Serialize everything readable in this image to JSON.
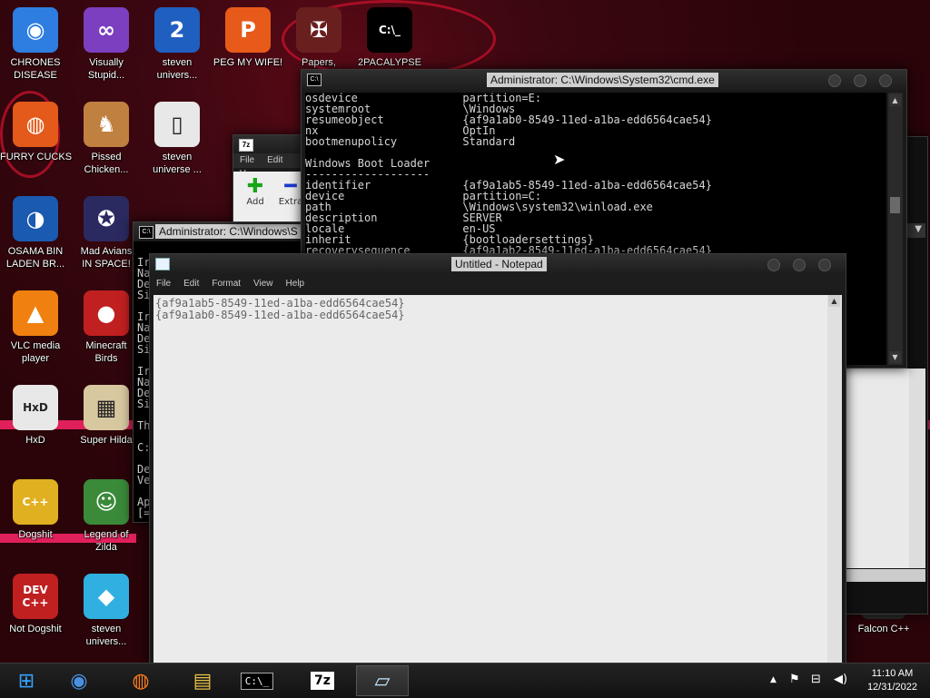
{
  "desktop": {
    "icons": [
      {
        "label": "CHRONES\nDISEASE",
        "glyph": "◉",
        "color": "#2e7de0"
      },
      {
        "label": "Visually\nStupid...",
        "glyph": "∞",
        "color": "#7b3fbf"
      },
      {
        "label": "steven\nunivers...",
        "glyph": "2",
        "color": "#1f5fc0"
      },
      {
        "label": "PEG MY WIFE!",
        "glyph": "P",
        "color": "#e85a1a"
      },
      {
        "label": "Papers,",
        "glyph": "✠",
        "color": "#6a1f1f"
      },
      {
        "label": "2PACALYPSE",
        "glyph": "C:\\_",
        "color": "#000000"
      },
      {
        "label": "FURRY CUCKS",
        "glyph": "◍",
        "color": "#e35a1a"
      },
      {
        "label": "Pissed\nChicken...",
        "glyph": "♞",
        "color": "#c08040"
      },
      {
        "label": "steven\nuniverse ...",
        "glyph": "▯",
        "color": "#e8e8e8"
      },
      {
        "label": "OSAMA BIN\nLADEN BR...",
        "glyph": "◑",
        "color": "#1a5ab0"
      },
      {
        "label": "Mad Avians\nIN SPACE!",
        "glyph": "✪",
        "color": "#2a2a60"
      },
      {
        "label": "VLC media\nplayer",
        "glyph": "▲",
        "color": "#f08010"
      },
      {
        "label": "Minecraft\nBirds",
        "glyph": "●",
        "color": "#c02020"
      },
      {
        "label": "HxD",
        "glyph": "HxD",
        "color": "#e8e8e8"
      },
      {
        "label": "Super Hilda",
        "glyph": "▦",
        "color": "#d8c8a0"
      },
      {
        "label": "Dogshit",
        "glyph": "C++",
        "color": "#e0b020"
      },
      {
        "label": "Legend of\nZilda",
        "glyph": "☺",
        "color": "#3a8a3a"
      },
      {
        "label": "Not Dogshit",
        "glyph": "DEV\nC++",
        "color": "#c02020"
      },
      {
        "label": "steven\nunivers...",
        "glyph": "◆",
        "color": "#30b0e0"
      },
      {
        "label": "Falcon C++",
        "glyph": "",
        "color": "#2a2a2a"
      }
    ]
  },
  "cmd_window": {
    "title": "Administrator: C:\\Windows\\System32\\cmd.exe",
    "lines": [
      "osdevice                partition=E:",
      "systemroot              \\Windows",
      "resumeobject            {af9a1ab0-8549-11ed-a1ba-edd6564cae54}",
      "nx                      OptIn",
      "bootmenupolicy          Standard",
      "",
      "Windows Boot Loader",
      "-------------------",
      "identifier              {af9a1ab5-8549-11ed-a1ba-edd6564cae54}",
      "device                  partition=C:",
      "path                    \\Windows\\system32\\winload.exe",
      "description             SERVER",
      "locale                  en-US",
      "inherit                 {bootloadersettings}",
      "recoverysequence        {af9a1ab2-8549-11ed-a1ba-edd6564cae54}"
    ]
  },
  "cmd_window_2": {
    "title": "Administrator: C:\\Windows\\S",
    "left_fragments": [
      "Ir",
      "Na",
      "De",
      "Si",
      "",
      "Ir",
      "Na",
      "De",
      "Si",
      "",
      "Ir",
      "Na",
      "De",
      "Si",
      "",
      "Th",
      "",
      "C:",
      "",
      "De",
      "Ve",
      "",
      "Ap",
      "[="
    ]
  },
  "sevenzip_window": {
    "icon": "7z",
    "menu": [
      "File",
      "Edit",
      "V"
    ],
    "toolbar": [
      {
        "label": "Add"
      },
      {
        "label": "Extra"
      }
    ]
  },
  "notepad": {
    "title": "Untitled - Notepad",
    "menu": [
      "File",
      "Edit",
      "Format",
      "View",
      "Help"
    ],
    "content": "{af9a1ab5-8549-11ed-a1ba-edd6564cae54}\n{af9a1ab0-8549-11ed-a1ba-edd6564cae54}"
  },
  "taskbar": {
    "apps": [
      {
        "name": "start-button",
        "glyph": "⊞"
      },
      {
        "name": "chrome",
        "glyph": "◉"
      },
      {
        "name": "firefox",
        "glyph": "◍"
      },
      {
        "name": "explorer",
        "glyph": "▤"
      },
      {
        "name": "cmd",
        "glyph": "C:\\_"
      },
      {
        "name": "7zip",
        "glyph": "7z"
      },
      {
        "name": "notepad",
        "glyph": "▱"
      }
    ],
    "time": "11:10 AM",
    "date": "12/31/2022"
  }
}
